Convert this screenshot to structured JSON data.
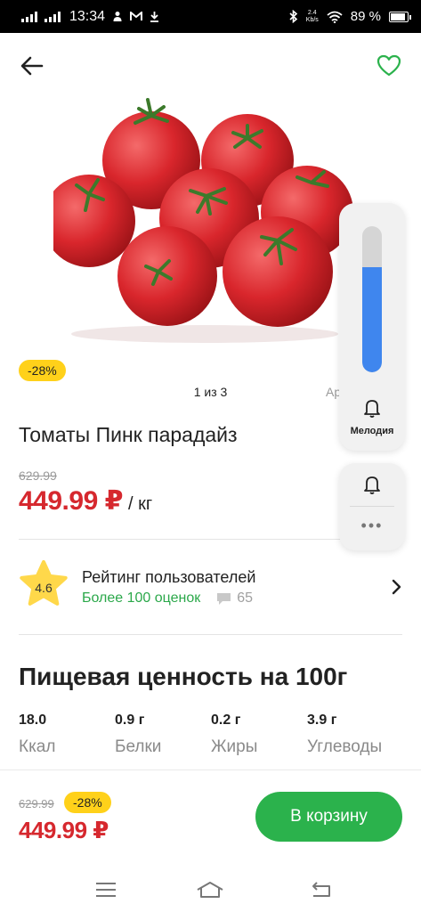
{
  "status_bar": {
    "time": "13:34",
    "speed_value": "2.4",
    "speed_unit": "Kb/s",
    "battery": "89 %"
  },
  "product": {
    "discount": "-28%",
    "pager": "1 из 3",
    "next_image_hint": "Ар",
    "title": "Томаты Пинк парадайз",
    "old_price": "629.99",
    "price": "449.99 ₽",
    "unit": "/ кг"
  },
  "rating": {
    "value": "4.6",
    "title": "Рейтинг пользователей",
    "count_label": "Более 100 оценок",
    "comments": "65"
  },
  "nutrition": {
    "heading": "Пищевая ценность на 100г",
    "items": [
      {
        "value": "18.0",
        "label": "Ккал"
      },
      {
        "value": "0.9 г",
        "label": "Белки"
      },
      {
        "value": "0.2 г",
        "label": "Жиры"
      },
      {
        "value": "3.9 г",
        "label": "Углеводы"
      }
    ]
  },
  "bottom_bar": {
    "old_price": "629.99",
    "discount": "-28%",
    "price": "449.99 ₽",
    "cart_button": "В корзину"
  },
  "volume_overlay": {
    "level_fraction": 0.72,
    "mode_label": "Мелодия"
  },
  "colors": {
    "accent_green": "#2bb24c",
    "price_red": "#d6282e",
    "badge_yellow": "#ffd11a",
    "volume_blue": "#3f86ee"
  },
  "icons": [
    "signal-icon",
    "usb-icon",
    "gmail-icon",
    "download-icon",
    "bluetooth-icon",
    "wifi-icon",
    "battery-icon",
    "back-arrow-icon",
    "heart-icon",
    "star-icon",
    "comment-icon",
    "chevron-right-icon",
    "bell-icon",
    "more-icon",
    "menu-icon",
    "home-icon",
    "back-icon"
  ]
}
